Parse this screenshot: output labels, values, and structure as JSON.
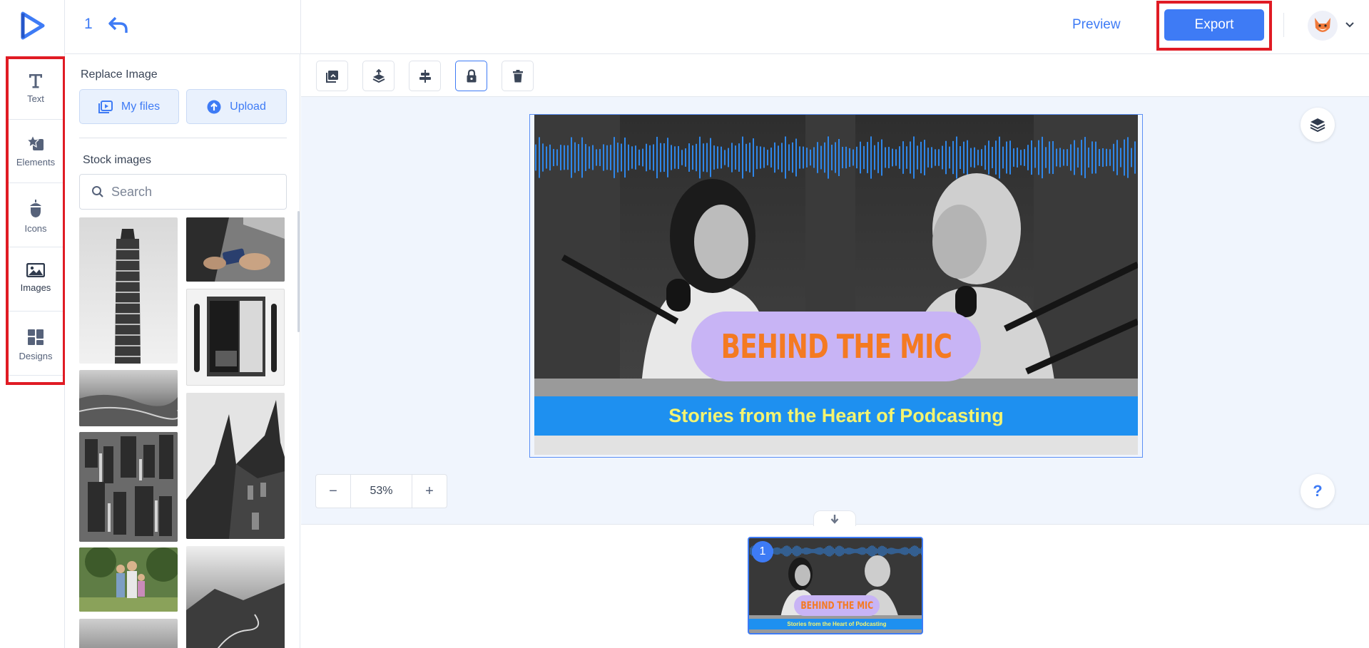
{
  "app": {
    "logo": "play-logo"
  },
  "colors": {
    "accent": "#3e7bf5",
    "highlight": "#e01b24",
    "title_pill": "#c8b4f5",
    "title_text": "#f47a22",
    "band": "#1e90f0",
    "band_text": "#f4f470"
  },
  "header": {
    "page_number": "1",
    "preview_label": "Preview",
    "export_label": "Export"
  },
  "rail": {
    "items": [
      {
        "label": "Text",
        "icon": "text-icon"
      },
      {
        "label": "Elements",
        "icon": "elements-icon"
      },
      {
        "label": "Icons",
        "icon": "icons-icon"
      },
      {
        "label": "Images",
        "icon": "images-icon"
      },
      {
        "label": "Designs",
        "icon": "designs-icon"
      }
    ]
  },
  "panel": {
    "replace_heading": "Replace Image",
    "my_files_label": "My files",
    "upload_label": "Upload",
    "stock_heading": "Stock images",
    "search_placeholder": "Search"
  },
  "canvas": {
    "title": "BEHIND THE MIC",
    "subtitle": "Stories from the Heart of Podcasting",
    "zoom": "53%",
    "zoom_out": "−",
    "zoom_in": "+",
    "help": "?"
  },
  "pages": {
    "current": "1",
    "thumb_title": "BEHIND THE MIC",
    "thumb_subtitle": "Stories from the Heart of Podcasting"
  }
}
